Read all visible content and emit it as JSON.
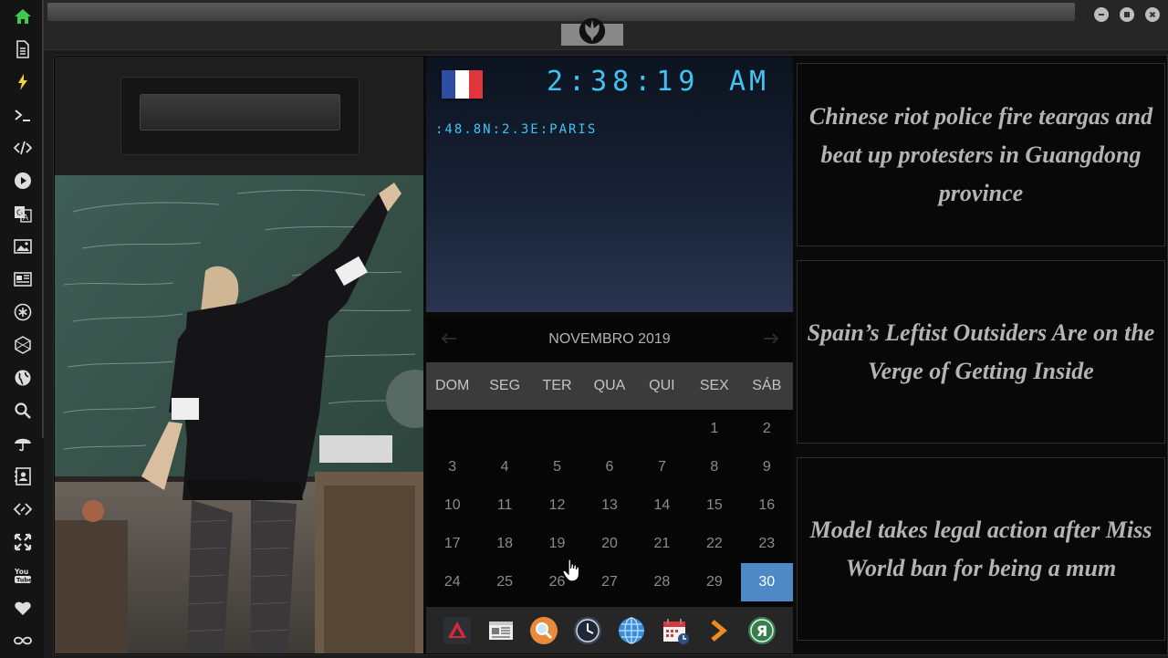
{
  "sidebar": {
    "items": [
      {
        "icon": "home-icon",
        "color": "#3ec94c"
      },
      {
        "icon": "document-icon"
      },
      {
        "icon": "lightning-icon",
        "color": "#f0d23a"
      },
      {
        "icon": "terminal-icon"
      },
      {
        "icon": "code-icon"
      },
      {
        "icon": "play-icon"
      },
      {
        "icon": "translate-icon"
      },
      {
        "icon": "image-icon"
      },
      {
        "icon": "newspaper-icon"
      },
      {
        "icon": "asterisk-icon"
      },
      {
        "icon": "hexagon-icon"
      },
      {
        "icon": "globe-icon"
      },
      {
        "icon": "search-icon"
      },
      {
        "icon": "umbrella-icon"
      },
      {
        "icon": "contacts-icon"
      },
      {
        "icon": "diamond-link-icon"
      },
      {
        "icon": "expand-icon"
      },
      {
        "icon": "youtube-icon"
      },
      {
        "icon": "heart-icon"
      },
      {
        "icon": "infinity-icon"
      }
    ]
  },
  "topbar": {
    "logo_icon": "rebel-alliance-icon",
    "window_buttons": [
      "minimize-icon",
      "maximize-icon",
      "close-icon"
    ]
  },
  "search": {
    "value": ""
  },
  "clock": {
    "flag": {
      "colors": [
        "#2d4ea3",
        "#ffffff",
        "#e0353b"
      ]
    },
    "time": "2:38:19",
    "ampm": "AM",
    "location": ":48.8N:2.3E:PARIS",
    "color": "#3fc4f2"
  },
  "calendar": {
    "title": "NOVEMBRO 2019",
    "prev_label": "←",
    "next_label": "→",
    "weekdays": [
      "DOM",
      "SEG",
      "TER",
      "QUA",
      "QUI",
      "SEX",
      "SÁB"
    ],
    "first_weekday_index": 5,
    "days_in_month": 30,
    "today": 30,
    "days": [
      "1",
      "2",
      "3",
      "4",
      "5",
      "6",
      "7",
      "8",
      "9",
      "10",
      "11",
      "12",
      "13",
      "14",
      "15",
      "16",
      "17",
      "18",
      "19",
      "20",
      "21",
      "22",
      "23",
      "24",
      "25",
      "26",
      "27",
      "28",
      "29",
      "30"
    ],
    "highlight_color": "#4f88c6"
  },
  "dock": {
    "apps": [
      "app-launcher-icon",
      "news-reader-icon",
      "search-app-icon",
      "clock-app-icon",
      "browser-globe-icon",
      "calendar-app-icon",
      "forward-arrow-icon",
      "yandex-icon"
    ]
  },
  "news": [
    {
      "headline": "Chinese riot police fire teargas and beat up protesters in Guangdong province"
    },
    {
      "headline": "Spain’s Leftist Outsiders Are on the Verge of Getting Inside"
    },
    {
      "headline": "Model takes legal action after Miss World ban for being a mum"
    }
  ]
}
